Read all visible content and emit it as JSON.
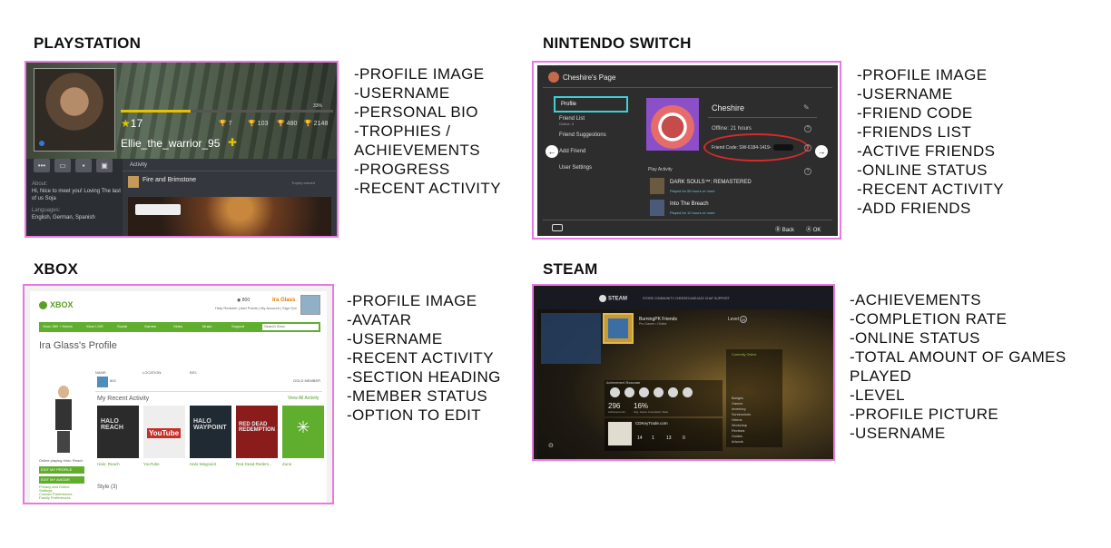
{
  "headings": {
    "ps": "PLAYSTATION",
    "ns": "NINTENDO SWITCH",
    "xbox": "XBOX",
    "steam": "STEAM"
  },
  "features": {
    "ps": [
      "-PROFILE IMAGE",
      "-USERNAME",
      "-PERSONAL BIO",
      "-TROPHIES /",
      "ACHIEVEMENTS",
      "-PROGRESS",
      "-RECENT ACTIVITY"
    ],
    "ns": [
      "-PROFILE IMAGE",
      "-USERNAME",
      "-FRIEND CODE",
      "-FRIENDS LIST",
      "-ACTIVE FRIENDS",
      "-ONLINE STATUS",
      "-RECENT ACTIVITY",
      "-ADD FRIENDS"
    ],
    "xbox": [
      "-PROFILE IMAGE",
      "-AVATAR",
      "-USERNAME",
      "-RECENT ACTIVITY",
      "-SECTION HEADING",
      "-MEMBER STATUS",
      "-OPTION TO EDIT"
    ],
    "steam": [
      "-ACHIEVEMENTS",
      "-COMPLETION RATE",
      "-ONLINE STATUS",
      "-TOTAL AMOUNT OF GAMES",
      "PLAYED",
      "-LEVEL",
      "-PROFILE PICTURE",
      "-USERNAME"
    ]
  },
  "ps": {
    "level": "17",
    "progress_pct": 0.33,
    "progress_label": "33%",
    "trophies": {
      "platinum": "7",
      "gold": "103",
      "silver": "480",
      "bronze": "2148"
    },
    "username": "Ellie_the_warrior_95",
    "about_label": "About:",
    "about": "Hi, Nice to meet you! Loving The last of us Soja",
    "languages_label": "Languages:",
    "languages": "English, German, Spanish",
    "activity_title": "Activity",
    "activity_game": "Fire and Brimstone",
    "activity_earned": "Trophy earned"
  },
  "ns": {
    "page_title": "Cheshire's Page",
    "menu": [
      {
        "label": "Profile",
        "sub": ""
      },
      {
        "label": "Friend List",
        "sub": "Online: 3"
      },
      {
        "label": "Friend Suggestions",
        "sub": ""
      },
      {
        "label": "Add Friend",
        "sub": ""
      },
      {
        "label": "User Settings",
        "sub": ""
      }
    ],
    "name": "Cheshire",
    "online": "Offline: 21 hours",
    "friend_code": "Friend Code: SW-6184-1419-",
    "activity_title": "Play Activity",
    "games": [
      {
        "name": "DARK SOULS™: REMASTERED",
        "time": "Played for 55 hours or more"
      },
      {
        "name": "Into The Breach",
        "time": "Played for 10 hours or more"
      }
    ],
    "back": "Back",
    "ok": "OK"
  },
  "xbox": {
    "logo": "XBOX",
    "gamertag": "Ira Glass",
    "points": "800",
    "links": "Help Redeem | Add Points | My Account | Sign Out",
    "nav": [
      "Xbox 360 + Kinect",
      "Xbox LIVE",
      "Social",
      "Games",
      "Video",
      "Music",
      "Support"
    ],
    "search_placeholder": "Search Xbox",
    "title": "Ira Glass's Profile",
    "online_playing": "Online playing Halo: Reach",
    "edit_profile": "EDIT MY PROFILE",
    "edit_avatar": "EDIT MY AVATAR",
    "small_links": [
      "Privacy and Online",
      "Settings",
      "Contact Preferences",
      "Family Preferences"
    ],
    "labels": {
      "name": "NAME:",
      "location": "LOCATION:",
      "bio": "BIO:"
    },
    "gold_member": "GOLD MEMBER",
    "score": "800",
    "recent_title": "My Recent Activity",
    "view_all": "View All Activity",
    "tiles": [
      {
        "label": "Halo: Reach",
        "color": "#2b2b2b",
        "text": "HALO REACH"
      },
      {
        "label": "YouTube",
        "color": "#eeeeee",
        "text": "YouTube"
      },
      {
        "label": "Halo Waypoint",
        "color": "#1f2a33",
        "text": "HALO WAYPOINT"
      },
      {
        "label": "Red Dead Redem...",
        "color": "#8a1c1c",
        "text": "RED DEAD REDEMPTION"
      },
      {
        "label": "Zune",
        "color": "#5fae2e",
        "text": "Zune"
      }
    ],
    "style": "Style (3)"
  },
  "steam": {
    "logo": "STEAM",
    "nav": "STORE   COMMUNITY   CHEESECAKEJAZZ   CHAT   SUPPORT",
    "username": "BurningPK Friends",
    "sub": "Pro Gamer • Online",
    "level_label": "Level",
    "level": "49",
    "right_items": [
      "Currently Online",
      "Badges",
      "Games",
      "Inventory",
      "Screenshots",
      "Videos",
      "Workshop",
      "Reviews",
      "Guides",
      "Artwork"
    ],
    "ach_heading": "Achievement Showcase",
    "ach_count": "296",
    "ach_count_label": "Achievements",
    "completion": "16%",
    "completion_label": "Avg. Game Completion Rate",
    "game_title": "CDKeyTrade.com",
    "game_nums": [
      "14",
      "1",
      "13",
      "0"
    ]
  }
}
